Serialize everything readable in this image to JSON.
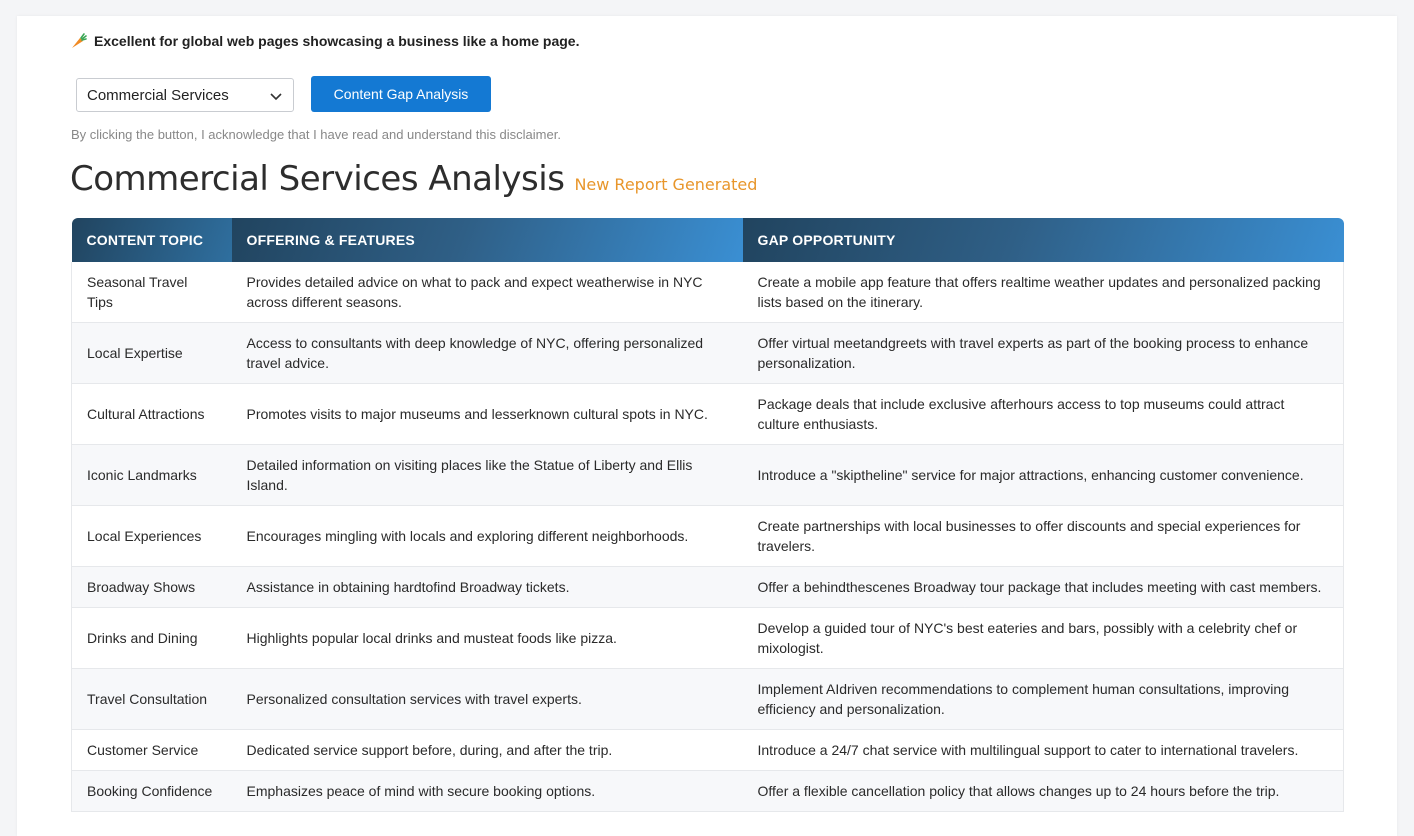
{
  "tip": {
    "icon": "carrot-icon",
    "text": "Excellent for global web pages showcasing a business like a home page."
  },
  "controls": {
    "select_value": "Commercial Services",
    "button_label": "Content Gap Analysis",
    "disclaimer": "By clicking the button, I acknowledge that I have read and understand this disclaimer."
  },
  "report": {
    "title": "Commercial Services Analysis",
    "badge": "New Report Generated"
  },
  "table": {
    "headers": [
      "CONTENT TOPIC",
      "OFFERING & FEATURES",
      "GAP OPPORTUNITY"
    ],
    "rows": [
      {
        "topic": "Seasonal Travel Tips",
        "offering": "Provides detailed advice on what to pack and expect weatherwise in NYC across different seasons.",
        "gap": "Create a mobile app feature that offers realtime weather updates and personalized packing lists based on the itinerary."
      },
      {
        "topic": "Local Expertise",
        "offering": "Access to consultants with deep knowledge of NYC, offering personalized travel advice.",
        "gap": "Offer virtual meetandgreets with travel experts as part of the booking process to enhance personalization."
      },
      {
        "topic": "Cultural Attractions",
        "offering": "Promotes visits to major museums and lesserknown cultural spots in NYC.",
        "gap": "Package deals that include exclusive afterhours access to top museums could attract culture enthusiasts."
      },
      {
        "topic": "Iconic Landmarks",
        "offering": "Detailed information on visiting places like the Statue of Liberty and Ellis Island.",
        "gap": "Introduce a \"skiptheline\" service for major attractions, enhancing customer convenience."
      },
      {
        "topic": "Local Experiences",
        "offering": "Encourages mingling with locals and exploring different neighborhoods.",
        "gap": "Create partnerships with local businesses to offer discounts and special experiences for travelers."
      },
      {
        "topic": "Broadway Shows",
        "offering": "Assistance in obtaining hardtofind Broadway tickets.",
        "gap": "Offer a behindthescenes Broadway tour package that includes meeting with cast members."
      },
      {
        "topic": "Drinks and Dining",
        "offering": "Highlights popular local drinks and musteat foods like pizza.",
        "gap": "Develop a guided tour of NYC's best eateries and bars, possibly with a celebrity chef or mixologist."
      },
      {
        "topic": "Travel Consultation",
        "offering": "Personalized consultation services with travel experts.",
        "gap": "Implement AIdriven recommendations to complement human consultations, improving efficiency and personalization."
      },
      {
        "topic": "Customer Service",
        "offering": "Dedicated service support before, during, and after the trip.",
        "gap": "Introduce a 24/7 chat service with multilingual support to cater to international travelers."
      },
      {
        "topic": "Booking Confidence",
        "offering": "Emphasizes peace of mind with secure booking options.",
        "gap": "Offer a flexible cancellation policy that allows changes up to 24 hours before the trip."
      }
    ]
  },
  "colors": {
    "accent": "#1479d3",
    "badge": "#e8962b",
    "header_dark": "#21445f",
    "header_light": "#3a8fd3"
  }
}
